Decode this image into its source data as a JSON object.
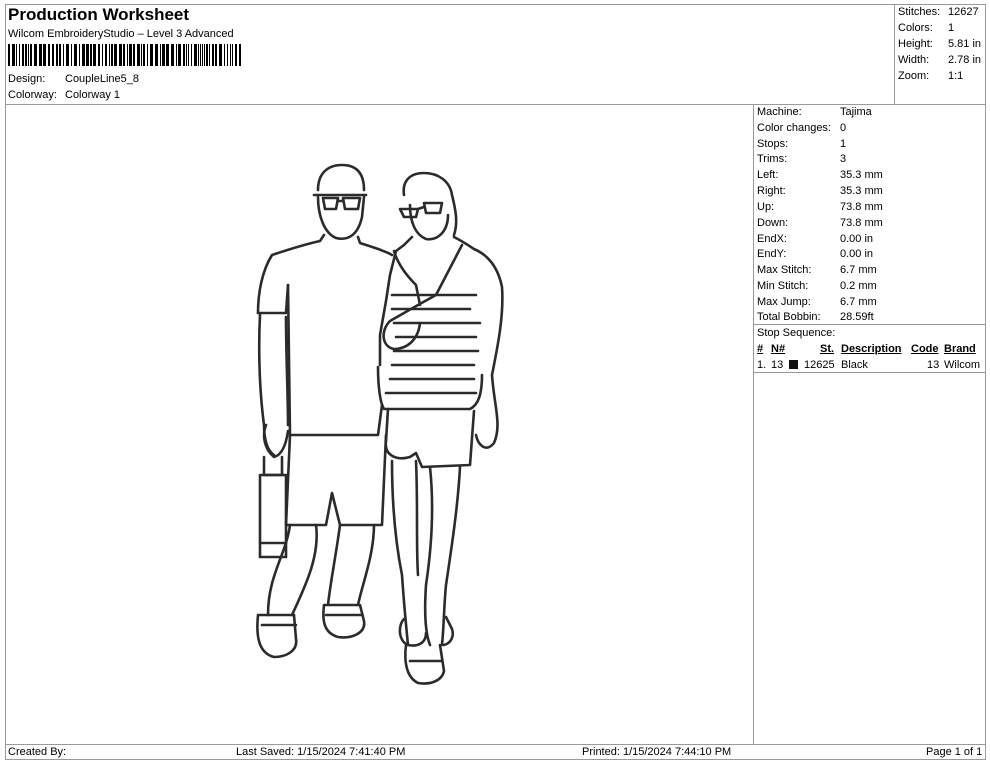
{
  "header": {
    "title": "Production Worksheet",
    "subtitle": "Wilcom EmbroideryStudio – Level 3 Advanced",
    "design_label": "Design:",
    "design_value": "CoupleLine5_8",
    "colorway_label": "Colorway:",
    "colorway_value": "Colorway 1"
  },
  "summary": [
    {
      "label": "Stitches:",
      "value": "12627"
    },
    {
      "label": "Colors:",
      "value": "1"
    },
    {
      "label": "Height:",
      "value": "5.81 in"
    },
    {
      "label": "Width:",
      "value": "2.78 in"
    },
    {
      "label": "Zoom:",
      "value": "1:1"
    }
  ],
  "details": [
    {
      "label": "Machine:",
      "value": "Tajima"
    },
    {
      "label": "Color changes:",
      "value": "0"
    },
    {
      "label": "Stops:",
      "value": "1"
    },
    {
      "label": "Trims:",
      "value": "3"
    },
    {
      "label": "Left:",
      "value": "35.3 mm"
    },
    {
      "label": "Right:",
      "value": "35.3 mm"
    },
    {
      "label": "Up:",
      "value": "73.8 mm"
    },
    {
      "label": "Down:",
      "value": "73.8 mm"
    },
    {
      "label": "EndX:",
      "value": "0.00 in"
    },
    {
      "label": "EndY:",
      "value": "0.00 in"
    },
    {
      "label": "Max Stitch:",
      "value": "6.7 mm"
    },
    {
      "label": "Min Stitch:",
      "value": "0.2 mm"
    },
    {
      "label": "Max Jump:",
      "value": "6.7 mm"
    },
    {
      "label": "Total Bobbin:",
      "value": "28.59ft"
    }
  ],
  "stop_sequence": {
    "title": "Stop Sequence:",
    "headers": {
      "num": "#",
      "n": "N#",
      "st": "St.",
      "description": "Description",
      "code": "Code",
      "brand": "Brand"
    },
    "rows": [
      {
        "num": "1.",
        "n": "13",
        "st": "12625",
        "description": "Black",
        "code": "13",
        "brand": "Wilcom",
        "color": "#111111"
      }
    ]
  },
  "footer": {
    "created_by": "Created By:",
    "last_saved": "Last Saved: 1/15/2024 7:41:40 PM",
    "printed": "Printed: 1/15/2024 7:44:10 PM",
    "page": "Page 1 of 1"
  },
  "design_preview": {
    "icon": "couple-line-art",
    "thread_color": "#2b2b2b"
  }
}
